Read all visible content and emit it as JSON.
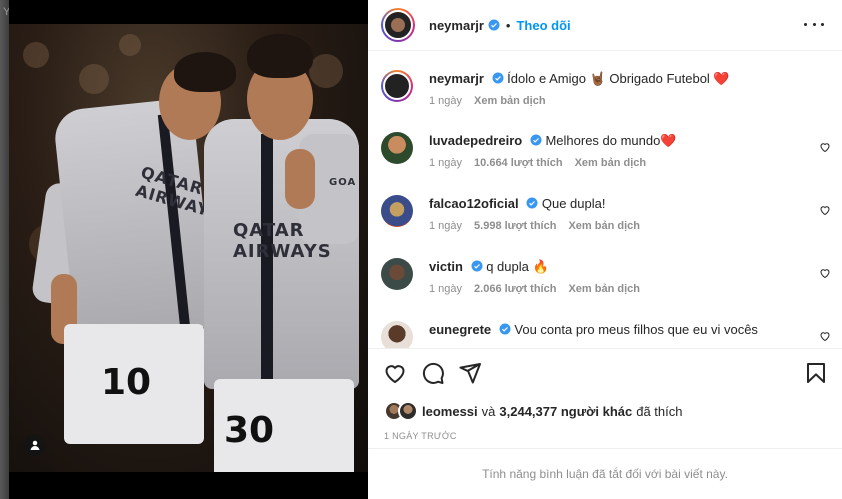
{
  "backdrop": {
    "tag": "Ya"
  },
  "post": {
    "author": "neymarjr",
    "follow_label": "Theo dõi",
    "dot": "•",
    "caption": {
      "user": "neymarjr",
      "text": "Ídolo e Amigo 🤘🏾 Obrigado Futebol ❤️",
      "time": "1 ngày",
      "translate": "Xem bản dịch"
    },
    "photo": {
      "sponsor_left": "QATAR AIRWAYS",
      "sponsor_right": "QATAR AIRWAYS",
      "number_left": "10",
      "number_right": "30",
      "brand_right": "GOA"
    }
  },
  "comments": [
    {
      "user": "luvadepedreiro",
      "text": "Melhores do mundo❤️",
      "time": "1 ngày",
      "likes": "10.664 lượt thích",
      "translate": "Xem bản dịch"
    },
    {
      "user": "falcao12oficial",
      "text": "Que dupla!",
      "time": "1 ngày",
      "likes": "5.998 lượt thích",
      "translate": "Xem bản dịch"
    },
    {
      "user": "victin",
      "text": "q dupla 🔥",
      "time": "1 ngày",
      "likes": "2.066 lượt thích",
      "translate": "Xem bản dịch"
    },
    {
      "user": "eunegrete",
      "text": "Vou conta pro meus filhos que eu vi vocês",
      "time": "",
      "likes": "",
      "translate": ""
    }
  ],
  "likes_summary": {
    "user": "leomessi",
    "connector": "và",
    "count": "3,244,377 người khác",
    "suffix": "đã thích"
  },
  "date_label": "1 NGÀY TRƯỚC",
  "footer_text": "Tính năng bình luận đã tắt đối với bài viết này.",
  "icons": {
    "like": "heart-icon",
    "comment": "comment-icon",
    "share": "paper-plane-icon",
    "save": "bookmark-icon",
    "more": "more-options-icon",
    "verified": "verified-badge-icon",
    "user_tag": "user-tag-icon"
  },
  "colors": {
    "accent": "#0095f6",
    "verified": "#3897f0",
    "heart": "#ed4956",
    "muted": "#8e8e8e",
    "text": "#262626"
  }
}
